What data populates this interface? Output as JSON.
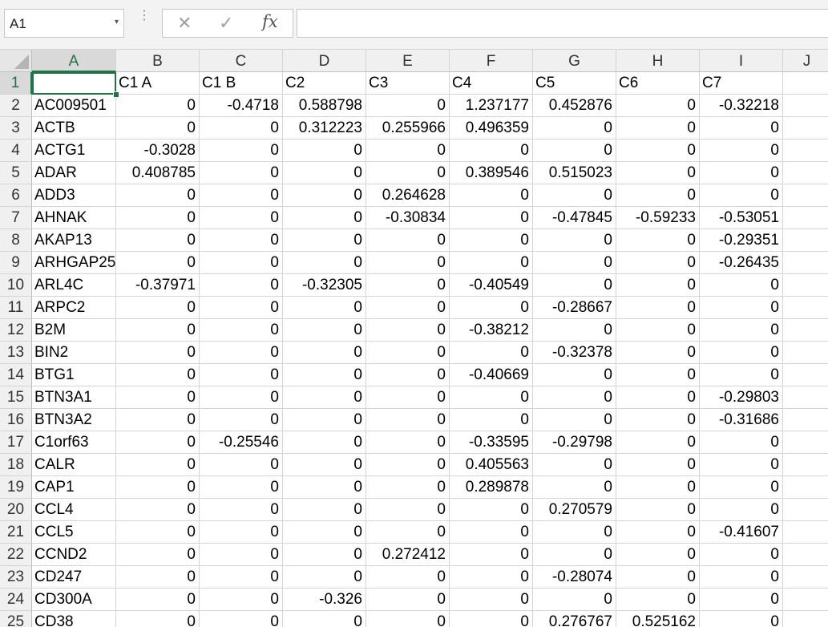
{
  "formula_bar": {
    "name_box": "A1",
    "name_box_arrow": "▾",
    "more_dots": "⋮",
    "cancel_label": "✕",
    "enter_label": "✓",
    "fx_label": "fx",
    "formula": ""
  },
  "colors": {
    "accent": "#217346",
    "header_bg": "#f0f0f0",
    "grid_line": "#d4d4d4"
  },
  "selected_cell": "A1",
  "columns": [
    "A",
    "B",
    "C",
    "D",
    "E",
    "F",
    "G",
    "H",
    "I",
    "J"
  ],
  "rows": [
    {
      "n": "1",
      "cells": [
        "",
        "C1 A",
        "C1 B",
        "C2",
        "C3",
        "C4",
        "C5",
        "C6",
        "C7",
        ""
      ]
    },
    {
      "n": "2",
      "cells": [
        "AC009501",
        "0",
        "-0.4718",
        "0.588798",
        "0",
        "1.237177",
        "0.452876",
        "0",
        "-0.32218",
        ""
      ]
    },
    {
      "n": "3",
      "cells": [
        "ACTB",
        "0",
        "0",
        "0.312223",
        "0.255966",
        "0.496359",
        "0",
        "0",
        "0",
        ""
      ]
    },
    {
      "n": "4",
      "cells": [
        "ACTG1",
        "-0.3028",
        "0",
        "0",
        "0",
        "0",
        "0",
        "0",
        "0",
        ""
      ]
    },
    {
      "n": "5",
      "cells": [
        "ADAR",
        "0.408785",
        "0",
        "0",
        "0",
        "0.389546",
        "0.515023",
        "0",
        "0",
        ""
      ]
    },
    {
      "n": "6",
      "cells": [
        "ADD3",
        "0",
        "0",
        "0",
        "0.264628",
        "0",
        "0",
        "0",
        "0",
        ""
      ]
    },
    {
      "n": "7",
      "cells": [
        "AHNAK",
        "0",
        "0",
        "0",
        "-0.30834",
        "0",
        "-0.47845",
        "-0.59233",
        "-0.53051",
        ""
      ]
    },
    {
      "n": "8",
      "cells": [
        "AKAP13",
        "0",
        "0",
        "0",
        "0",
        "0",
        "0",
        "0",
        "-0.29351",
        ""
      ]
    },
    {
      "n": "9",
      "cells": [
        "ARHGAP25",
        "0",
        "0",
        "0",
        "0",
        "0",
        "0",
        "0",
        "-0.26435",
        ""
      ]
    },
    {
      "n": "10",
      "cells": [
        "ARL4C",
        "-0.37971",
        "0",
        "-0.32305",
        "0",
        "-0.40549",
        "0",
        "0",
        "0",
        ""
      ]
    },
    {
      "n": "11",
      "cells": [
        "ARPC2",
        "0",
        "0",
        "0",
        "0",
        "0",
        "-0.28667",
        "0",
        "0",
        ""
      ]
    },
    {
      "n": "12",
      "cells": [
        "B2M",
        "0",
        "0",
        "0",
        "0",
        "-0.38212",
        "0",
        "0",
        "0",
        ""
      ]
    },
    {
      "n": "13",
      "cells": [
        "BIN2",
        "0",
        "0",
        "0",
        "0",
        "0",
        "-0.32378",
        "0",
        "0",
        ""
      ]
    },
    {
      "n": "14",
      "cells": [
        "BTG1",
        "0",
        "0",
        "0",
        "0",
        "-0.40669",
        "0",
        "0",
        "0",
        ""
      ]
    },
    {
      "n": "15",
      "cells": [
        "BTN3A1",
        "0",
        "0",
        "0",
        "0",
        "0",
        "0",
        "0",
        "-0.29803",
        ""
      ]
    },
    {
      "n": "16",
      "cells": [
        "BTN3A2",
        "0",
        "0",
        "0",
        "0",
        "0",
        "0",
        "0",
        "-0.31686",
        ""
      ]
    },
    {
      "n": "17",
      "cells": [
        "C1orf63",
        "0",
        "-0.25546",
        "0",
        "0",
        "-0.33595",
        "-0.29798",
        "0",
        "0",
        ""
      ]
    },
    {
      "n": "18",
      "cells": [
        "CALR",
        "0",
        "0",
        "0",
        "0",
        "0.405563",
        "0",
        "0",
        "0",
        ""
      ]
    },
    {
      "n": "19",
      "cells": [
        "CAP1",
        "0",
        "0",
        "0",
        "0",
        "0.289878",
        "0",
        "0",
        "0",
        ""
      ]
    },
    {
      "n": "20",
      "cells": [
        "CCL4",
        "0",
        "0",
        "0",
        "0",
        "0",
        "0.270579",
        "0",
        "0",
        ""
      ]
    },
    {
      "n": "21",
      "cells": [
        "CCL5",
        "0",
        "0",
        "0",
        "0",
        "0",
        "0",
        "0",
        "-0.41607",
        ""
      ]
    },
    {
      "n": "22",
      "cells": [
        "CCND2",
        "0",
        "0",
        "0",
        "0.272412",
        "0",
        "0",
        "0",
        "0",
        ""
      ]
    },
    {
      "n": "23",
      "cells": [
        "CD247",
        "0",
        "0",
        "0",
        "0",
        "0",
        "-0.28074",
        "0",
        "0",
        ""
      ]
    },
    {
      "n": "24",
      "cells": [
        "CD300A",
        "0",
        "0",
        "-0.326",
        "0",
        "0",
        "0",
        "0",
        "0",
        ""
      ]
    },
    {
      "n": "25",
      "cells": [
        "CD38",
        "0",
        "0",
        "0",
        "0",
        "0",
        "0.276767",
        "0.525162",
        "0",
        ""
      ]
    }
  ]
}
